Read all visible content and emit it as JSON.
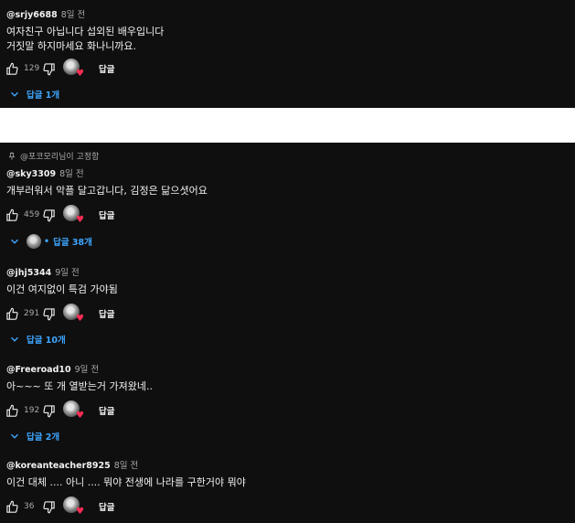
{
  "reply_label": "답글",
  "pinned_label": "@포코모리님이 고정함",
  "colors": {
    "bg": "#0f0f0f",
    "text": "#f1f1f1",
    "meta": "#aaaaaa",
    "link": "#3ea6ff",
    "heart": "#ff2d55",
    "gap": "#ffffff"
  },
  "comments": [
    {
      "author": "@srjy6688",
      "time": "8일 전",
      "lines": [
        "여자친구 아닙니다 섭외된 배우입니다",
        "거짓말 하지마세요 화나니까요."
      ],
      "likes": "129",
      "replies": "답글 1개"
    },
    {
      "author": "@sky3309",
      "time": "8일 전",
      "lines": [
        "개부러워서 악플 달고갑니다, 김정은 닮으셧어요"
      ],
      "likes": "459",
      "replies": "답글 38개"
    },
    {
      "author": "@jhj5344",
      "time": "9일 전",
      "lines": [
        "이건 여지없이 특검 가야됨"
      ],
      "likes": "291",
      "replies": "답글 10개"
    },
    {
      "author": "@Freeroad10",
      "time": "9일 전",
      "lines": [
        "아~~~ 또 개 열받는거 가져왔네.."
      ],
      "likes": "192",
      "replies": "답글 2개"
    },
    {
      "author": "@koreanteacher8925",
      "time": "8일 전",
      "lines": [
        "이건 대체 .... 아니 .... 뭐야 전생에 나라를 구한거야 뭐야"
      ],
      "likes": "36"
    }
  ]
}
